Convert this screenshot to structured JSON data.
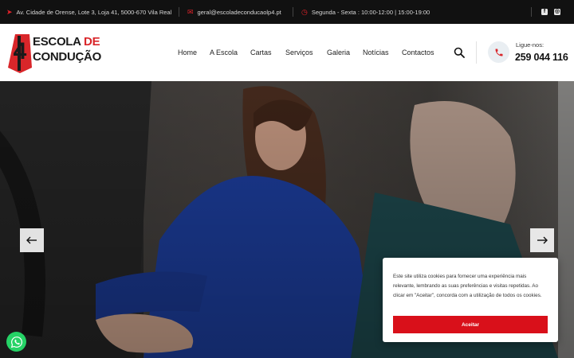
{
  "topbar": {
    "address": "Av. Cidade de Orense, Lote 3, Loja 41, 5000-670 Vila Real",
    "email": "geral@escoladeconducaolp4.pt",
    "hours": "Segunda - Sexta : 10:00-12:00 | 15:00-19:00",
    "social": [
      {
        "name": "facebook-icon",
        "glyph": "f"
      },
      {
        "name": "instagram-icon",
        "glyph": "◎"
      }
    ]
  },
  "logo": {
    "line1_dark": "ESCOLA",
    "line1_red": "DE",
    "line2": "CONDUÇÃO",
    "badge_number": "4"
  },
  "nav": {
    "items": [
      "Home",
      "A Escola",
      "Cartas",
      "Serviços",
      "Galeria",
      "Notícias",
      "Contactos"
    ]
  },
  "contact": {
    "call_label": "Ligue-nos:",
    "phone": "259 044 116"
  },
  "cookie": {
    "text": "Este site utiliza cookies para fornecer uma experiência mais relevante, lembrando as suas preferências e visitas repetidas. Ao clicar em \"Aceitar\", concorda com a utilização de todos os cookies.",
    "accept_label": "Aceitar"
  },
  "colors": {
    "brand_red": "#d9262a",
    "topbar_bg": "#111111",
    "whatsapp_green": "#25d366"
  }
}
